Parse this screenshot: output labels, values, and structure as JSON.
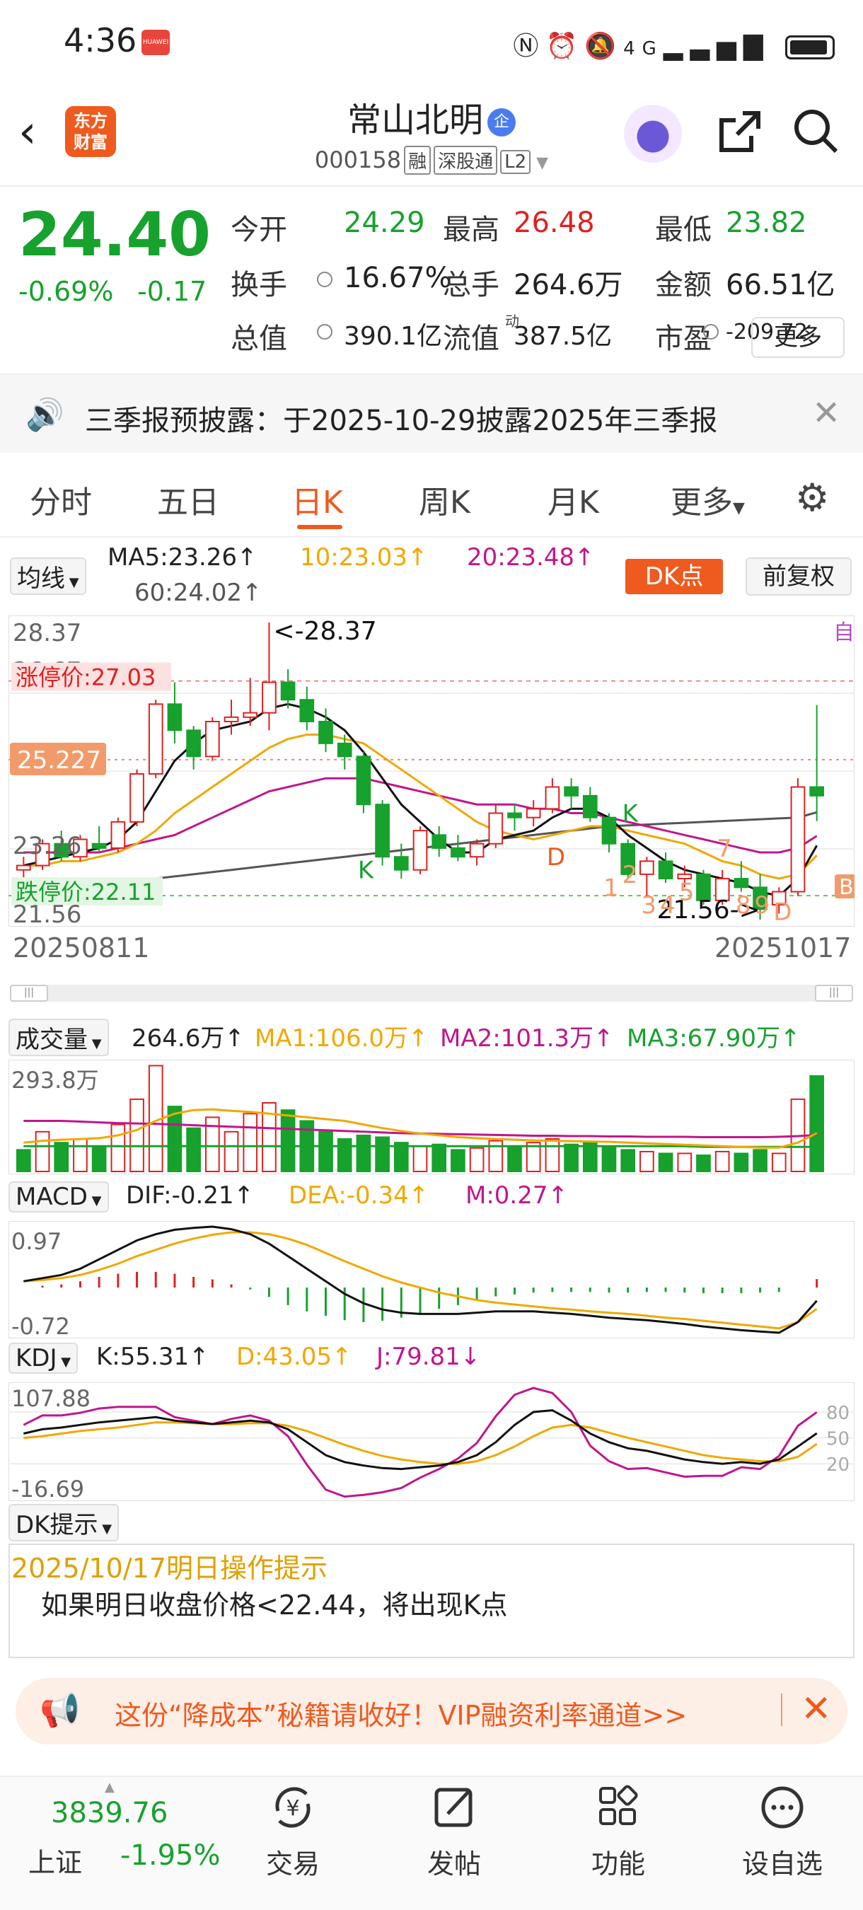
{
  "status": {
    "time": "4:36",
    "badge": "HUAWEI",
    "network": "4G"
  },
  "header": {
    "name": "常山北明",
    "badge": "企",
    "code": "000158",
    "tags": [
      "融",
      "深股通",
      "L2"
    ],
    "logo": "东方\n财富"
  },
  "quote": {
    "price": "24.40",
    "pct": "-0.69%",
    "chg": "-0.17",
    "rows": [
      [
        {
          "label": "今开",
          "value": "24.29",
          "color": "green"
        },
        {
          "label": "最高",
          "value": "26.48",
          "color": "red"
        },
        {
          "label": "最低",
          "value": "23.82",
          "color": "green"
        }
      ],
      [
        {
          "label": "换手",
          "value": "16.67%",
          "color": "dark"
        },
        {
          "label": "总手",
          "value": "264.6万",
          "color": "dark"
        },
        {
          "label": "金额",
          "value": "66.51亿",
          "color": "dark"
        }
      ],
      [
        {
          "label": "总值",
          "value": "390.1亿",
          "color": "dark"
        },
        {
          "label": "流值",
          "value": "387.5亿",
          "color": "dark"
        },
        {
          "label": "市盈",
          "value": "-209.72",
          "color": "dark"
        }
      ]
    ],
    "pe_sup": "动",
    "more": "更多"
  },
  "notice": {
    "text": "三季报预披露：于2025-10-29披露2025年三季报"
  },
  "tabs": [
    "分时",
    "五日",
    "日K",
    "周K",
    "月K",
    "更多"
  ],
  "active_tab": "日K",
  "kline_legend": {
    "selector": "均线",
    "ma5": "MA5:23.26↑",
    "ma10": "10:23.03↑",
    "ma20": "20:23.48↑",
    "ma60": "60:24.02↑",
    "dk": "DK点",
    "fq": "前复权"
  },
  "kline_labels": {
    "ymax": "28.37",
    "ymin": "21.56",
    "y_mid1": "26.67",
    "y_mid2": "23.26",
    "zhangting": "涨停价:27.03",
    "dieting": "跌停价:22.11",
    "current": "25.227",
    "high_ann": "<-28.37",
    "low_ann": "21.56->",
    "start_date": "20250811",
    "end_date": "20251017",
    "zi": "自",
    "b": "B",
    "markers": [
      "K",
      "D",
      "K",
      "1",
      "2",
      "3",
      "4",
      "5",
      "7",
      "8",
      "9",
      "D"
    ]
  },
  "volume_legend": {
    "selector": "成交量",
    "v": "264.6万↑",
    "ma1": "MA1:106.0万↑",
    "ma2": "MA2:101.3万↑",
    "ma3": "MA3:67.90万↑",
    "ymax": "293.8万"
  },
  "macd_legend": {
    "selector": "MACD",
    "dif": "DIF:-0.21↑",
    "dea": "DEA:-0.34↑",
    "m": "M:0.27↑",
    "ymax": "0.97",
    "ymin": "-0.72"
  },
  "kdj_legend": {
    "selector": "KDJ",
    "k": "K:55.31↑",
    "d": "D:43.05↑",
    "j": "J:79.81↓",
    "ymax": "107.88",
    "ymin": "-16.69",
    "l80": "80",
    "l50": "50",
    "l20": "20"
  },
  "dk_tips": {
    "selector": "DK提示",
    "date": "2025/10/17明日操作提示",
    "text": "如果明日收盘价格<22.44，将出现K点"
  },
  "promo": {
    "text": "这份“降成本”秘籍请收好！VIP融资利率通道>>"
  },
  "bottom": {
    "index_value": "3839.76",
    "index_name": "上证",
    "index_pct": "-1.95%",
    "items": [
      {
        "icon": "yuan-exchange-icon",
        "label": "交易"
      },
      {
        "icon": "edit-icon",
        "label": "发帖"
      },
      {
        "icon": "grid-icon",
        "label": "功能"
      },
      {
        "icon": "more-dots-icon",
        "label": "设自选"
      }
    ]
  },
  "colors": {
    "up": "#e02020",
    "down": "#17a12d",
    "accent": "#ef5a1e",
    "ma10": "#f0a800",
    "ma20": "#c0168c"
  },
  "chart_data": [
    {
      "type": "candlestick",
      "title": "日K",
      "x_range": [
        "20250811",
        "20251017"
      ],
      "ylim": [
        21.56,
        28.37
      ],
      "candles": [
        [
          22.7,
          23.0,
          22.5,
          22.8
        ],
        [
          22.8,
          23.4,
          22.7,
          23.3
        ],
        [
          23.3,
          23.6,
          22.9,
          23.0
        ],
        [
          23.0,
          23.5,
          22.9,
          23.4
        ],
        [
          23.3,
          23.7,
          23.1,
          23.2
        ],
        [
          23.2,
          23.9,
          23.1,
          23.8
        ],
        [
          23.8,
          25.0,
          23.7,
          24.9
        ],
        [
          24.9,
          26.6,
          24.8,
          26.5
        ],
        [
          26.5,
          27.0,
          25.6,
          25.9
        ],
        [
          25.9,
          26.0,
          25.0,
          25.3
        ],
        [
          25.3,
          26.2,
          25.2,
          26.1
        ],
        [
          26.1,
          26.6,
          25.8,
          26.2
        ],
        [
          26.2,
          27.1,
          26.0,
          26.3
        ],
        [
          26.3,
          28.37,
          25.9,
          27.0
        ],
        [
          27.0,
          27.3,
          26.4,
          26.6
        ],
        [
          26.6,
          26.9,
          25.9,
          26.1
        ],
        [
          26.1,
          26.4,
          25.4,
          25.6
        ],
        [
          25.6,
          25.8,
          25.0,
          25.3
        ],
        [
          25.3,
          25.4,
          24.0,
          24.2
        ],
        [
          24.2,
          24.3,
          22.8,
          23.0
        ],
        [
          23.0,
          23.3,
          22.5,
          22.7
        ],
        [
          22.7,
          23.7,
          22.6,
          23.6
        ],
        [
          23.5,
          23.7,
          23.0,
          23.2
        ],
        [
          23.2,
          23.5,
          22.9,
          23.0
        ],
        [
          23.0,
          23.4,
          22.8,
          23.3
        ],
        [
          23.3,
          24.2,
          23.2,
          24.0
        ],
        [
          24.0,
          24.2,
          23.6,
          23.9
        ],
        [
          23.9,
          24.3,
          23.7,
          24.1
        ],
        [
          24.1,
          24.8,
          24.0,
          24.6
        ],
        [
          24.6,
          24.8,
          24.1,
          24.4
        ],
        [
          24.4,
          24.6,
          23.8,
          23.9
        ],
        [
          23.9,
          24.0,
          23.1,
          23.3
        ],
        [
          23.3,
          23.4,
          22.5,
          22.6
        ],
        [
          22.6,
          23.0,
          22.1,
          22.9
        ],
        [
          22.9,
          23.1,
          22.4,
          22.5
        ],
        [
          22.5,
          22.8,
          22.3,
          22.6
        ],
        [
          22.6,
          22.7,
          21.9,
          22.0
        ],
        [
          22.0,
          22.7,
          21.9,
          22.5
        ],
        [
          22.5,
          22.9,
          22.2,
          22.3
        ],
        [
          22.3,
          22.6,
          21.56,
          21.8
        ],
        [
          21.9,
          22.3,
          21.7,
          22.2
        ],
        [
          22.2,
          24.8,
          22.1,
          24.6
        ],
        [
          24.6,
          26.48,
          23.82,
          24.4
        ]
      ],
      "ma5": [
        22.8,
        22.9,
        23.0,
        23.1,
        23.2,
        23.4,
        23.8,
        24.5,
        25.2,
        25.6,
        25.9,
        26.0,
        26.1,
        26.4,
        26.5,
        26.4,
        26.2,
        25.9,
        25.4,
        24.8,
        24.2,
        23.8,
        23.4,
        23.1,
        23.1,
        23.4,
        23.5,
        23.6,
        23.9,
        24.1,
        24.1,
        23.9,
        23.5,
        23.2,
        22.9,
        22.7,
        22.6,
        22.5,
        22.4,
        22.2,
        22.1,
        22.5,
        23.26
      ],
      "ma10": [
        22.8,
        22.8,
        22.9,
        22.9,
        23.0,
        23.1,
        23.3,
        23.6,
        24.0,
        24.3,
        24.6,
        24.9,
        25.2,
        25.5,
        25.7,
        25.8,
        25.8,
        25.7,
        25.6,
        25.3,
        25.0,
        24.7,
        24.4,
        24.1,
        23.8,
        23.6,
        23.5,
        23.4,
        23.5,
        23.6,
        23.7,
        23.7,
        23.6,
        23.5,
        23.4,
        23.3,
        23.1,
        22.9,
        22.8,
        22.6,
        22.5,
        22.6,
        23.03
      ],
      "ma20": [
        23.1,
        23.1,
        23.1,
        23.1,
        23.1,
        23.2,
        23.3,
        23.4,
        23.5,
        23.7,
        23.9,
        24.1,
        24.3,
        24.5,
        24.6,
        24.7,
        24.8,
        24.8,
        24.8,
        24.7,
        24.6,
        24.5,
        24.4,
        24.3,
        24.2,
        24.2,
        24.2,
        24.1,
        24.1,
        24.0,
        24.0,
        23.9,
        23.8,
        23.7,
        23.6,
        23.5,
        23.4,
        23.3,
        23.2,
        23.1,
        23.1,
        23.2,
        23.48
      ],
      "ma60": [
        22.2,
        22.2,
        22.25,
        22.3,
        22.35,
        22.4,
        22.45,
        22.5,
        22.55,
        22.6,
        22.65,
        22.7,
        22.75,
        22.8,
        22.85,
        22.9,
        22.95,
        23.0,
        23.05,
        23.1,
        23.15,
        23.2,
        23.25,
        23.3,
        23.35,
        23.4,
        23.45,
        23.5,
        23.55,
        23.6,
        23.65,
        23.7,
        23.72,
        23.74,
        23.76,
        23.78,
        23.8,
        23.82,
        23.84,
        23.86,
        23.88,
        23.9,
        24.02
      ]
    },
    {
      "type": "bar",
      "title": "成交量",
      "ylim": [
        0,
        293.8
      ],
      "values": [
        60,
        110,
        80,
        90,
        70,
        130,
        200,
        293,
        180,
        120,
        150,
        110,
        160,
        190,
        170,
        140,
        110,
        90,
        100,
        95,
        80,
        70,
        75,
        60,
        65,
        85,
        70,
        80,
        90,
        75,
        80,
        70,
        60,
        55,
        50,
        50,
        45,
        55,
        50,
        60,
        50,
        200,
        264.6
      ],
      "up": [
        false,
        true,
        false,
        true,
        false,
        true,
        true,
        true,
        false,
        false,
        true,
        true,
        true,
        true,
        false,
        false,
        false,
        false,
        false,
        false,
        false,
        true,
        false,
        false,
        true,
        true,
        false,
        true,
        true,
        false,
        false,
        false,
        false,
        true,
        false,
        true,
        false,
        true,
        false,
        false,
        true,
        true,
        false
      ],
      "ma1": [
        80,
        85,
        88,
        90,
        92,
        100,
        115,
        140,
        160,
        170,
        172,
        168,
        165,
        160,
        155,
        150,
        145,
        140,
        130,
        120,
        112,
        105,
        100,
        95,
        92,
        90,
        88,
        86,
        85,
        84,
        83,
        82,
        80,
        78,
        76,
        74,
        72,
        70,
        68,
        66,
        66,
        80,
        106.0
      ],
      "ma2": [
        140,
        140,
        140,
        138,
        136,
        134,
        133,
        132,
        130,
        128,
        126,
        124,
        122,
        120,
        118,
        116,
        114,
        112,
        110,
        108,
        106,
        105,
        104,
        103,
        102,
        101,
        100,
        99,
        99,
        98,
        98,
        97,
        97,
        96,
        96,
        96,
        95,
        95,
        95,
        95,
        96,
        98,
        101.3
      ],
      "ma3": [
        70,
        70,
        70,
        70,
        70,
        70,
        70,
        70,
        70,
        70,
        70,
        70,
        70,
        70,
        70,
        70,
        70,
        70,
        70,
        70,
        70,
        70,
        70,
        70,
        70,
        70,
        70,
        70,
        70,
        70,
        70,
        70,
        70,
        70,
        70,
        70,
        68,
        68,
        68,
        68,
        68,
        68,
        67.9
      ]
    },
    {
      "type": "line",
      "title": "MACD",
      "ylim": [
        -0.72,
        0.97
      ],
      "dif": [
        0.1,
        0.15,
        0.2,
        0.3,
        0.45,
        0.6,
        0.75,
        0.85,
        0.92,
        0.95,
        0.97,
        0.93,
        0.85,
        0.7,
        0.5,
        0.3,
        0.1,
        -0.1,
        -0.25,
        -0.35,
        -0.4,
        -0.42,
        -0.42,
        -0.42,
        -0.4,
        -0.38,
        -0.38,
        -0.38,
        -0.4,
        -0.42,
        -0.45,
        -0.48,
        -0.5,
        -0.52,
        -0.55,
        -0.58,
        -0.62,
        -0.65,
        -0.68,
        -0.7,
        -0.72,
        -0.55,
        -0.21
      ],
      "dea": [
        0.1,
        0.12,
        0.15,
        0.2,
        0.28,
        0.38,
        0.5,
        0.6,
        0.7,
        0.78,
        0.84,
        0.88,
        0.88,
        0.85,
        0.78,
        0.68,
        0.55,
        0.42,
        0.3,
        0.18,
        0.08,
        0.0,
        -0.08,
        -0.14,
        -0.2,
        -0.24,
        -0.27,
        -0.3,
        -0.33,
        -0.35,
        -0.38,
        -0.4,
        -0.42,
        -0.45,
        -0.48,
        -0.5,
        -0.53,
        -0.56,
        -0.59,
        -0.62,
        -0.65,
        -0.55,
        -0.34
      ],
      "m": [
        0.0,
        0.06,
        0.1,
        0.2,
        0.34,
        0.44,
        0.5,
        0.5,
        0.44,
        0.34,
        0.26,
        0.1,
        -0.06,
        -0.3,
        -0.56,
        -0.76,
        -0.9,
        -1.04,
        -1.1,
        -1.06,
        -0.96,
        -0.84,
        -0.68,
        -0.56,
        -0.4,
        -0.28,
        -0.22,
        -0.16,
        -0.14,
        -0.14,
        -0.14,
        -0.16,
        -0.16,
        -0.14,
        -0.14,
        -0.16,
        -0.18,
        -0.18,
        -0.18,
        -0.16,
        -0.14,
        0.0,
        0.27
      ]
    },
    {
      "type": "line",
      "title": "KDJ",
      "ylim": [
        -16.69,
        107.88
      ],
      "k": [
        55,
        60,
        62,
        65,
        68,
        70,
        72,
        74,
        70,
        68,
        66,
        68,
        70,
        68,
        60,
        45,
        30,
        22,
        18,
        15,
        14,
        16,
        18,
        22,
        30,
        45,
        65,
        80,
        82,
        70,
        55,
        45,
        38,
        35,
        30,
        25,
        22,
        20,
        22,
        20,
        25,
        40,
        55.31
      ],
      "d": [
        50,
        52,
        55,
        58,
        60,
        62,
        65,
        68,
        68,
        67,
        66,
        66,
        67,
        67,
        64,
        58,
        50,
        42,
        35,
        29,
        25,
        22,
        20,
        20,
        23,
        30,
        40,
        52,
        62,
        65,
        62,
        56,
        50,
        45,
        40,
        35,
        30,
        27,
        25,
        23,
        23,
        28,
        43.05
      ],
      "j": [
        65,
        76,
        76,
        79,
        84,
        86,
        86,
        86,
        74,
        70,
        66,
        72,
        76,
        70,
        52,
        19,
        -10,
        -18,
        -16,
        -13,
        -8,
        4,
        14,
        26,
        44,
        75,
        100,
        107.88,
        102,
        80,
        41,
        23,
        14,
        15,
        10,
        5,
        6,
        6,
        16,
        14,
        29,
        64,
        79.81
      ]
    }
  ]
}
